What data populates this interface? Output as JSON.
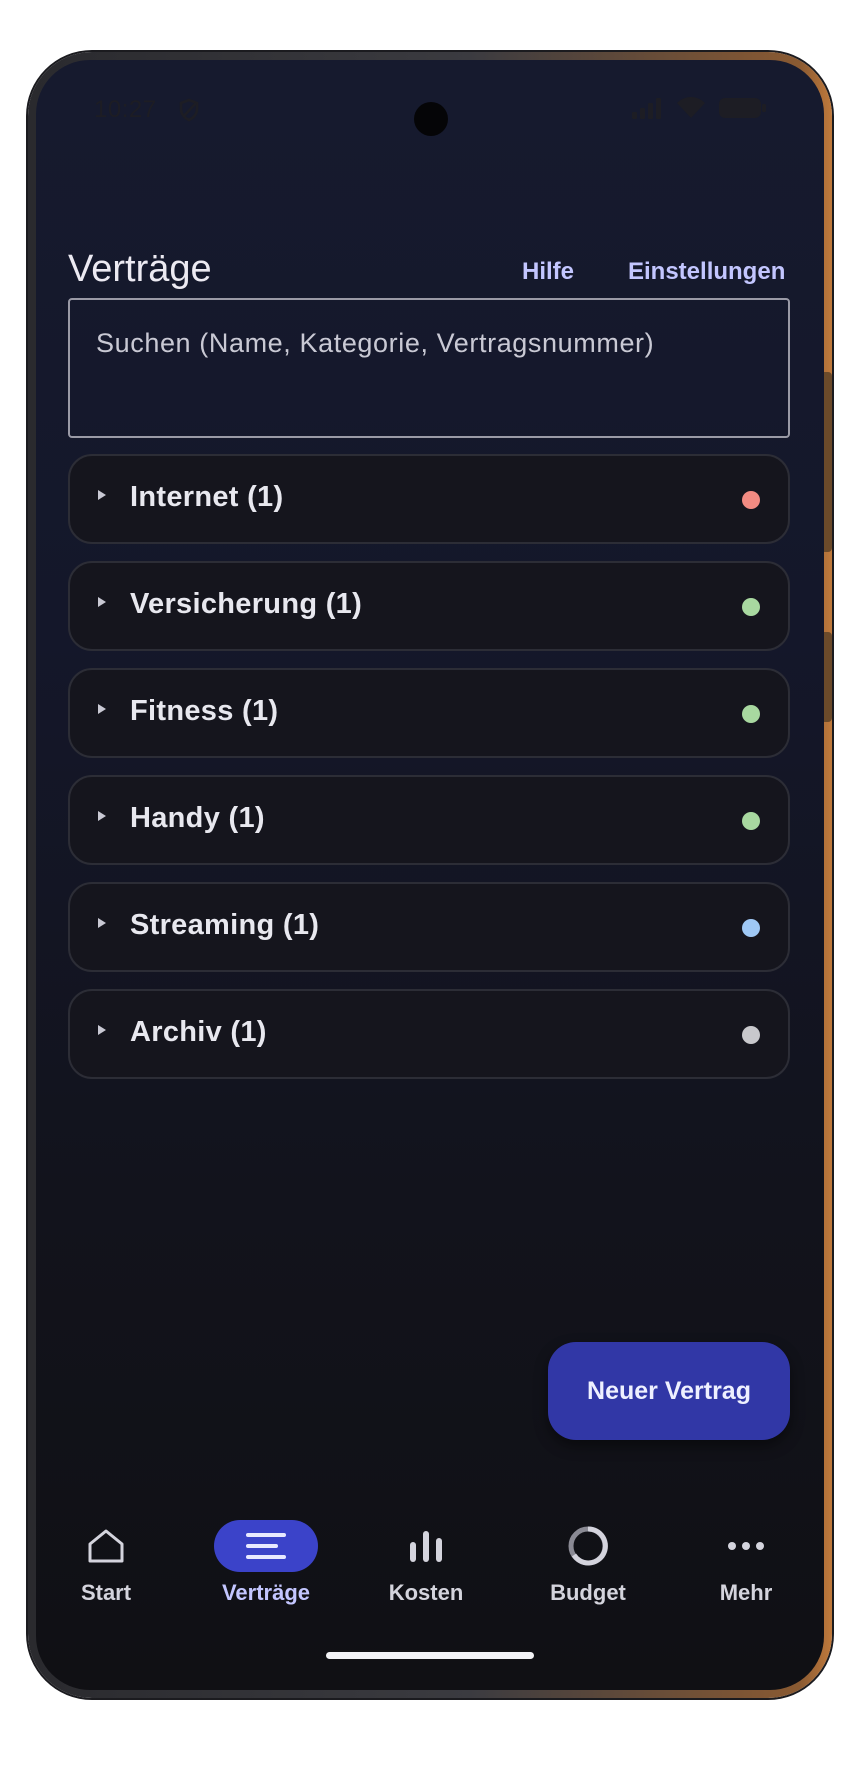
{
  "status_bar": {
    "time": "10:27",
    "icons": [
      "shield-icon",
      "signal-icon",
      "wifi-icon",
      "battery-icon"
    ]
  },
  "header": {
    "title": "Verträge",
    "help_label": "Hilfe",
    "settings_label": "Einstellungen"
  },
  "search": {
    "placeholder": "Suchen (Name, Kategorie, Vertragsnummer)"
  },
  "categories": [
    {
      "label": "Internet (1)",
      "dot_color": "#f28b82"
    },
    {
      "label": "Versicherung (1)",
      "dot_color": "#a8d8a0"
    },
    {
      "label": "Fitness (1)",
      "dot_color": "#a8d8a0"
    },
    {
      "label": "Handy (1)",
      "dot_color": "#a8d8a0"
    },
    {
      "label": "Streaming (1)",
      "dot_color": "#9fc8f5"
    },
    {
      "label": "Archiv (1)",
      "dot_color": "#c8c8cc"
    }
  ],
  "fab": {
    "label": "Neuer Vertrag"
  },
  "bottom_nav": {
    "items": [
      {
        "label": "Start",
        "icon": "home-icon",
        "active": false
      },
      {
        "label": "Verträge",
        "icon": "menu-lines-icon",
        "active": true
      },
      {
        "label": "Kosten",
        "icon": "bar-chart-icon",
        "active": false
      },
      {
        "label": "Budget",
        "icon": "donut-icon",
        "active": false
      },
      {
        "label": "Mehr",
        "icon": "more-dots-icon",
        "active": false
      }
    ]
  },
  "colors": {
    "accent": "#3b43c9",
    "fab": "#3137a6",
    "link": "#c3c6ff",
    "background": "#14172a"
  }
}
